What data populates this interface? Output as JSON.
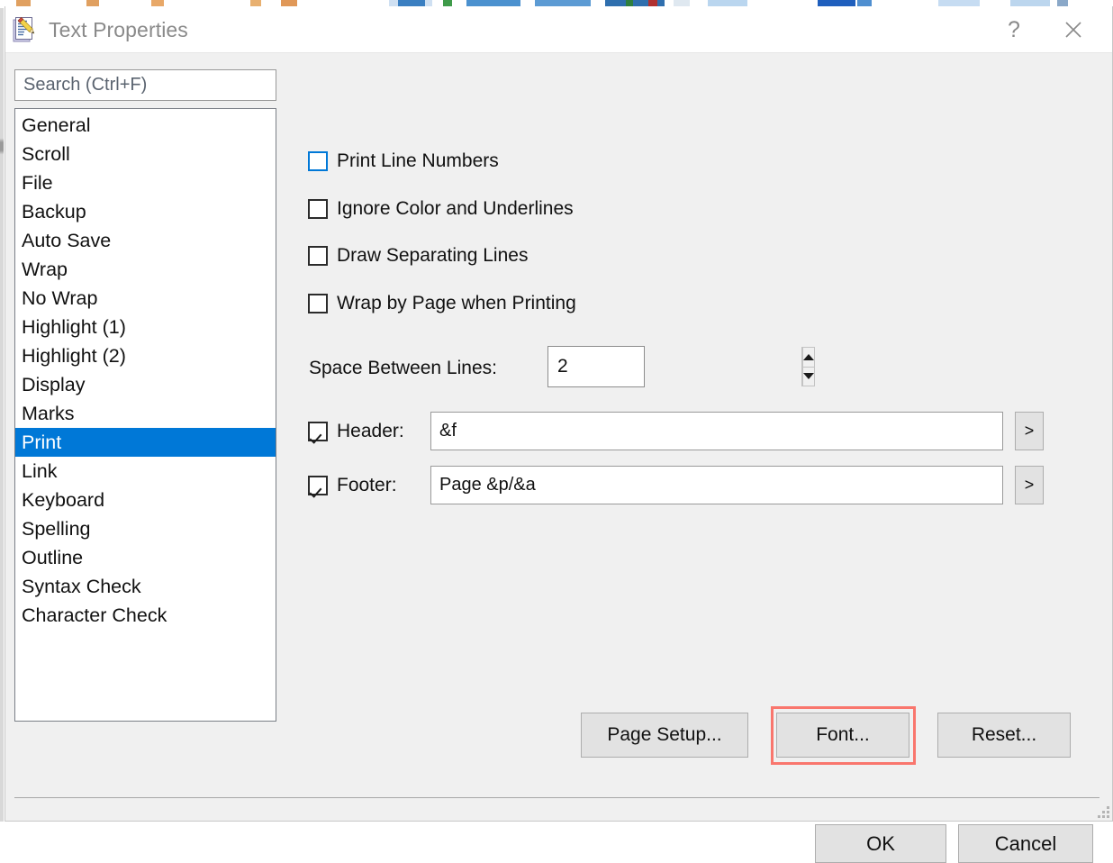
{
  "window": {
    "title": "Text Properties",
    "icon": "notepad-pencil-icon",
    "help_label": "?",
    "close_label": "✕"
  },
  "sidebar": {
    "search": {
      "value": "",
      "placeholder": "Search (Ctrl+F)"
    },
    "items": [
      {
        "label": "General",
        "selected": false
      },
      {
        "label": "Scroll",
        "selected": false
      },
      {
        "label": "File",
        "selected": false
      },
      {
        "label": "Backup",
        "selected": false
      },
      {
        "label": "Auto Save",
        "selected": false
      },
      {
        "label": "Wrap",
        "selected": false
      },
      {
        "label": "No Wrap",
        "selected": false
      },
      {
        "label": "Highlight (1)",
        "selected": false
      },
      {
        "label": "Highlight (2)",
        "selected": false
      },
      {
        "label": "Display",
        "selected": false
      },
      {
        "label": "Marks",
        "selected": false
      },
      {
        "label": "Print",
        "selected": true
      },
      {
        "label": "Link",
        "selected": false
      },
      {
        "label": "Keyboard",
        "selected": false
      },
      {
        "label": "Spelling",
        "selected": false
      },
      {
        "label": "Outline",
        "selected": false
      },
      {
        "label": "Syntax Check",
        "selected": false
      },
      {
        "label": "Character Check",
        "selected": false
      }
    ]
  },
  "panel": {
    "checkboxes": [
      {
        "label": "Print Line Numbers",
        "checked": false,
        "focused": true
      },
      {
        "label": "Ignore Color and Underlines",
        "checked": false,
        "focused": false
      },
      {
        "label": "Draw Separating Lines",
        "checked": false,
        "focused": false
      },
      {
        "label": "Wrap by Page when Printing",
        "checked": false,
        "focused": false
      }
    ],
    "space_between_lines": {
      "label": "Space Between Lines:",
      "value": "2"
    },
    "header": {
      "label": "Header:",
      "checked": true,
      "value": "&f",
      "more_label": ">"
    },
    "footer": {
      "label": "Footer:",
      "checked": true,
      "value": "Page &p/&a",
      "more_label": ">"
    },
    "buttons": {
      "page_setup": "Page Setup...",
      "font": "Font...",
      "reset": "Reset..."
    },
    "highlight_color": "#f9766d"
  },
  "footer": {
    "ok": "OK",
    "cancel": "Cancel"
  },
  "colors": {
    "accent": "#0078d7",
    "dialog_bg": "#f0f0f0",
    "button_bg": "#e2e2e2",
    "highlight_box": "#f9766d"
  }
}
